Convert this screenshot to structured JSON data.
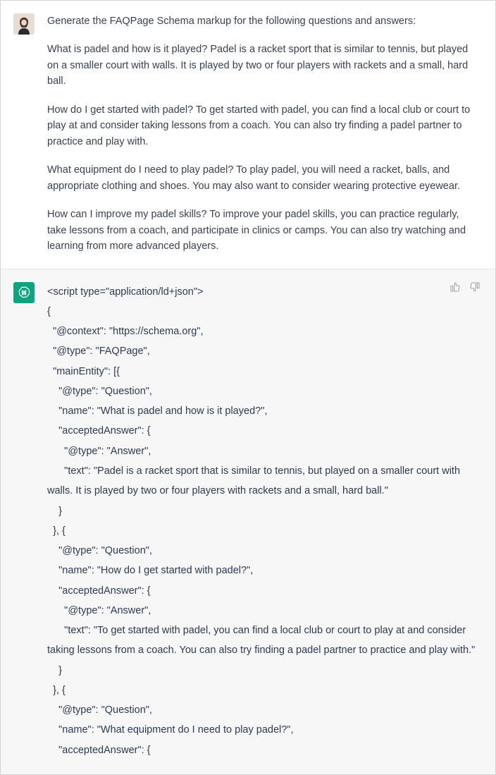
{
  "user_message": {
    "intro": "Generate the FAQPage Schema markup for the following questions and answers:",
    "qa1": "What is padel and how is it played? Padel is a racket sport that is similar to tennis, but played on a smaller court with walls. It is played by two or four players with rackets and a small, hard ball.",
    "qa2": "How do I get started with padel? To get started with padel, you can find a local club or court to play at and consider taking lessons from a coach. You can also try finding a padel partner to practice and play with.",
    "qa3": "What equipment do I need to play padel? To play padel, you will need a racket, balls, and appropriate clothing and shoes. You may also want to consider wearing protective eyewear.",
    "qa4": "How can I improve my padel skills? To improve your padel skills, you can practice regularly, take lessons from a coach, and participate in clinics or camps. You can also try watching and learning from more advanced players."
  },
  "assistant_code": "<script type=\"application/ld+json\">\n{\n  \"@context\": \"https://schema.org\",\n  \"@type\": \"FAQPage\",\n  \"mainEntity\": [{\n    \"@type\": \"Question\",\n    \"name\": \"What is padel and how is it played?\",\n    \"acceptedAnswer\": {\n      \"@type\": \"Answer\",\n      \"text\": \"Padel is a racket sport that is similar to tennis, but played on a smaller court with walls. It is played by two or four players with rackets and a small, hard ball.\"\n    }\n  }, {\n    \"@type\": \"Question\",\n    \"name\": \"How do I get started with padel?\",\n    \"acceptedAnswer\": {\n      \"@type\": \"Answer\",\n      \"text\": \"To get started with padel, you can find a local club or court to play at and consider taking lessons from a coach. You can also try finding a padel partner to practice and play with.\"\n    }\n  }, {\n    \"@type\": \"Question\",\n    \"name\": \"What equipment do I need to play padel?\",\n    \"acceptedAnswer\": {"
}
